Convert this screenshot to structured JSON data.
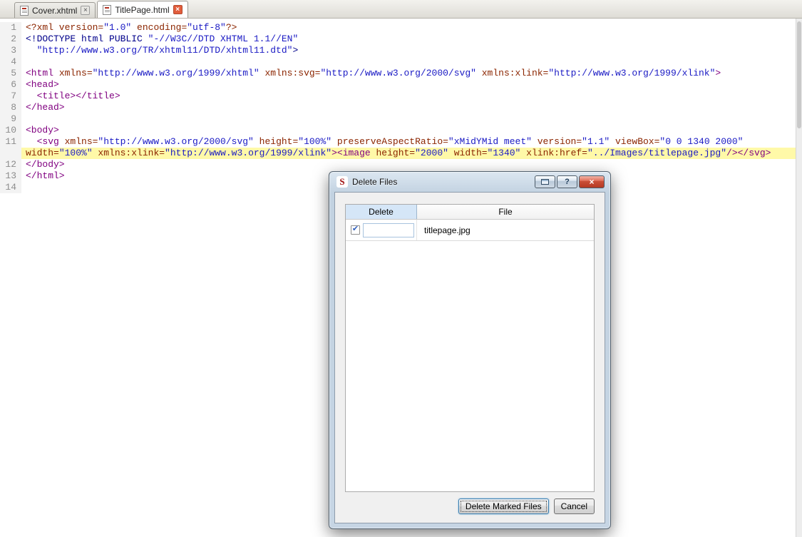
{
  "tabs": [
    {
      "label": "Cover.xhtml",
      "icon": "html-document-icon",
      "close_icon": "close-tab-icon",
      "active": false
    },
    {
      "label": "TitlePage.html",
      "icon": "html-document-icon",
      "close_icon": "close-tab-icon",
      "active": true
    }
  ],
  "icons": {
    "close_glyph": "×",
    "check_glyph": "✔",
    "help_glyph": "?"
  },
  "colors": {
    "code-tag": "#800080",
    "code-attr": "#8B2500",
    "code-string": "#1A1AC4",
    "code-doctype": "#00008B",
    "code-pi": "#8B2500",
    "line-highlight": "#FFF9A8",
    "gutter-text": "#8C8C8C",
    "dialog-glass": "#C6D5E4",
    "header-selected": "#D5E6F7",
    "close-red": "#C94F38",
    "tab-close-red": "#E25D3C"
  },
  "editor": {
    "lines": [
      {
        "num": "1",
        "tokens": [
          {
            "t": "pi",
            "s": "<?xml version="
          },
          {
            "t": "str",
            "s": "\"1.0\""
          },
          {
            "t": "pi",
            "s": " encoding="
          },
          {
            "t": "str",
            "s": "\"utf-8\""
          },
          {
            "t": "pi",
            "s": "?>"
          }
        ]
      },
      {
        "num": "2",
        "tokens": [
          {
            "t": "doc",
            "s": "<!DOCTYPE html PUBLIC "
          },
          {
            "t": "str",
            "s": "\"-//W3C//DTD XHTML 1.1//EN\""
          }
        ]
      },
      {
        "num": "3",
        "tokens": [
          {
            "t": "str",
            "s": "  \"http://www.w3.org/TR/xhtml11/DTD/xhtml11.dtd\""
          },
          {
            "t": "doc",
            "s": ">"
          }
        ]
      },
      {
        "num": "4",
        "tokens": []
      },
      {
        "num": "5",
        "tokens": [
          {
            "t": "tag",
            "s": "<html"
          },
          {
            "t": "attr",
            "s": " xmlns="
          },
          {
            "t": "str",
            "s": "\"http://www.w3.org/1999/xhtml\""
          },
          {
            "t": "attr",
            "s": " xmlns:svg="
          },
          {
            "t": "str",
            "s": "\"http://www.w3.org/2000/svg\""
          },
          {
            "t": "attr",
            "s": " xmlns:xlink="
          },
          {
            "t": "str",
            "s": "\"http://www.w3.org/1999/xlink\""
          },
          {
            "t": "tag",
            "s": ">"
          }
        ]
      },
      {
        "num": "6",
        "tokens": [
          {
            "t": "tag",
            "s": "<head>"
          }
        ]
      },
      {
        "num": "7",
        "tokens": [
          {
            "t": "tag",
            "s": "  <title></title>"
          }
        ]
      },
      {
        "num": "8",
        "tokens": [
          {
            "t": "tag",
            "s": "</head>"
          }
        ]
      },
      {
        "num": "9",
        "tokens": []
      },
      {
        "num": "10",
        "tokens": [
          {
            "t": "tag",
            "s": "<body>"
          }
        ]
      },
      {
        "num": "11",
        "tokens": [
          {
            "t": "tag",
            "s": "  <svg"
          },
          {
            "t": "attr",
            "s": " xmlns="
          },
          {
            "t": "str",
            "s": "\"http://www.w3.org/2000/svg\""
          },
          {
            "t": "attr",
            "s": " height="
          },
          {
            "t": "str",
            "s": "\"100%\""
          },
          {
            "t": "attr",
            "s": " preserveAspectRatio="
          },
          {
            "t": "str",
            "s": "\"xMidYMid meet\""
          },
          {
            "t": "attr",
            "s": " version="
          },
          {
            "t": "str",
            "s": "\"1.1\""
          },
          {
            "t": "attr",
            "s": " viewBox="
          },
          {
            "t": "str",
            "s": "\"0 0 1340 2000\""
          }
        ]
      },
      {
        "num": "",
        "hl": true,
        "tokens": [
          {
            "t": "attr",
            "s": "width="
          },
          {
            "t": "str",
            "s": "\"100%\""
          },
          {
            "t": "attr",
            "s": " xmlns:xlink="
          },
          {
            "t": "str",
            "s": "\"http://www.w3.org/1999/xlink\""
          },
          {
            "t": "tag",
            "s": "><image"
          },
          {
            "t": "attr",
            "s": " height="
          },
          {
            "t": "str",
            "s": "\"2000\""
          },
          {
            "t": "attr",
            "s": " width="
          },
          {
            "t": "str",
            "s": "\"1340\""
          },
          {
            "t": "attr",
            "s": " xlink:href="
          },
          {
            "t": "str",
            "s": "\"../Images/titlepage.jpg\""
          },
          {
            "t": "tag",
            "s": "/></svg>"
          }
        ]
      },
      {
        "num": "12",
        "tokens": [
          {
            "t": "tag",
            "s": "</body>"
          }
        ]
      },
      {
        "num": "13",
        "tokens": [
          {
            "t": "tag",
            "s": "</html>"
          }
        ]
      },
      {
        "num": "14",
        "tokens": []
      }
    ]
  },
  "dialog": {
    "title": "Delete Files",
    "window_icon": "sigil-logo-icon",
    "caption_buttons": [
      "toolbar-button",
      "help-button",
      "close-button"
    ],
    "table": {
      "headers": [
        "Delete",
        "File"
      ],
      "rows": [
        {
          "checked": true,
          "file": "titlepage.jpg"
        }
      ]
    },
    "buttons": {
      "delete_label": "Delete Marked Files",
      "cancel_label": "Cancel"
    }
  }
}
